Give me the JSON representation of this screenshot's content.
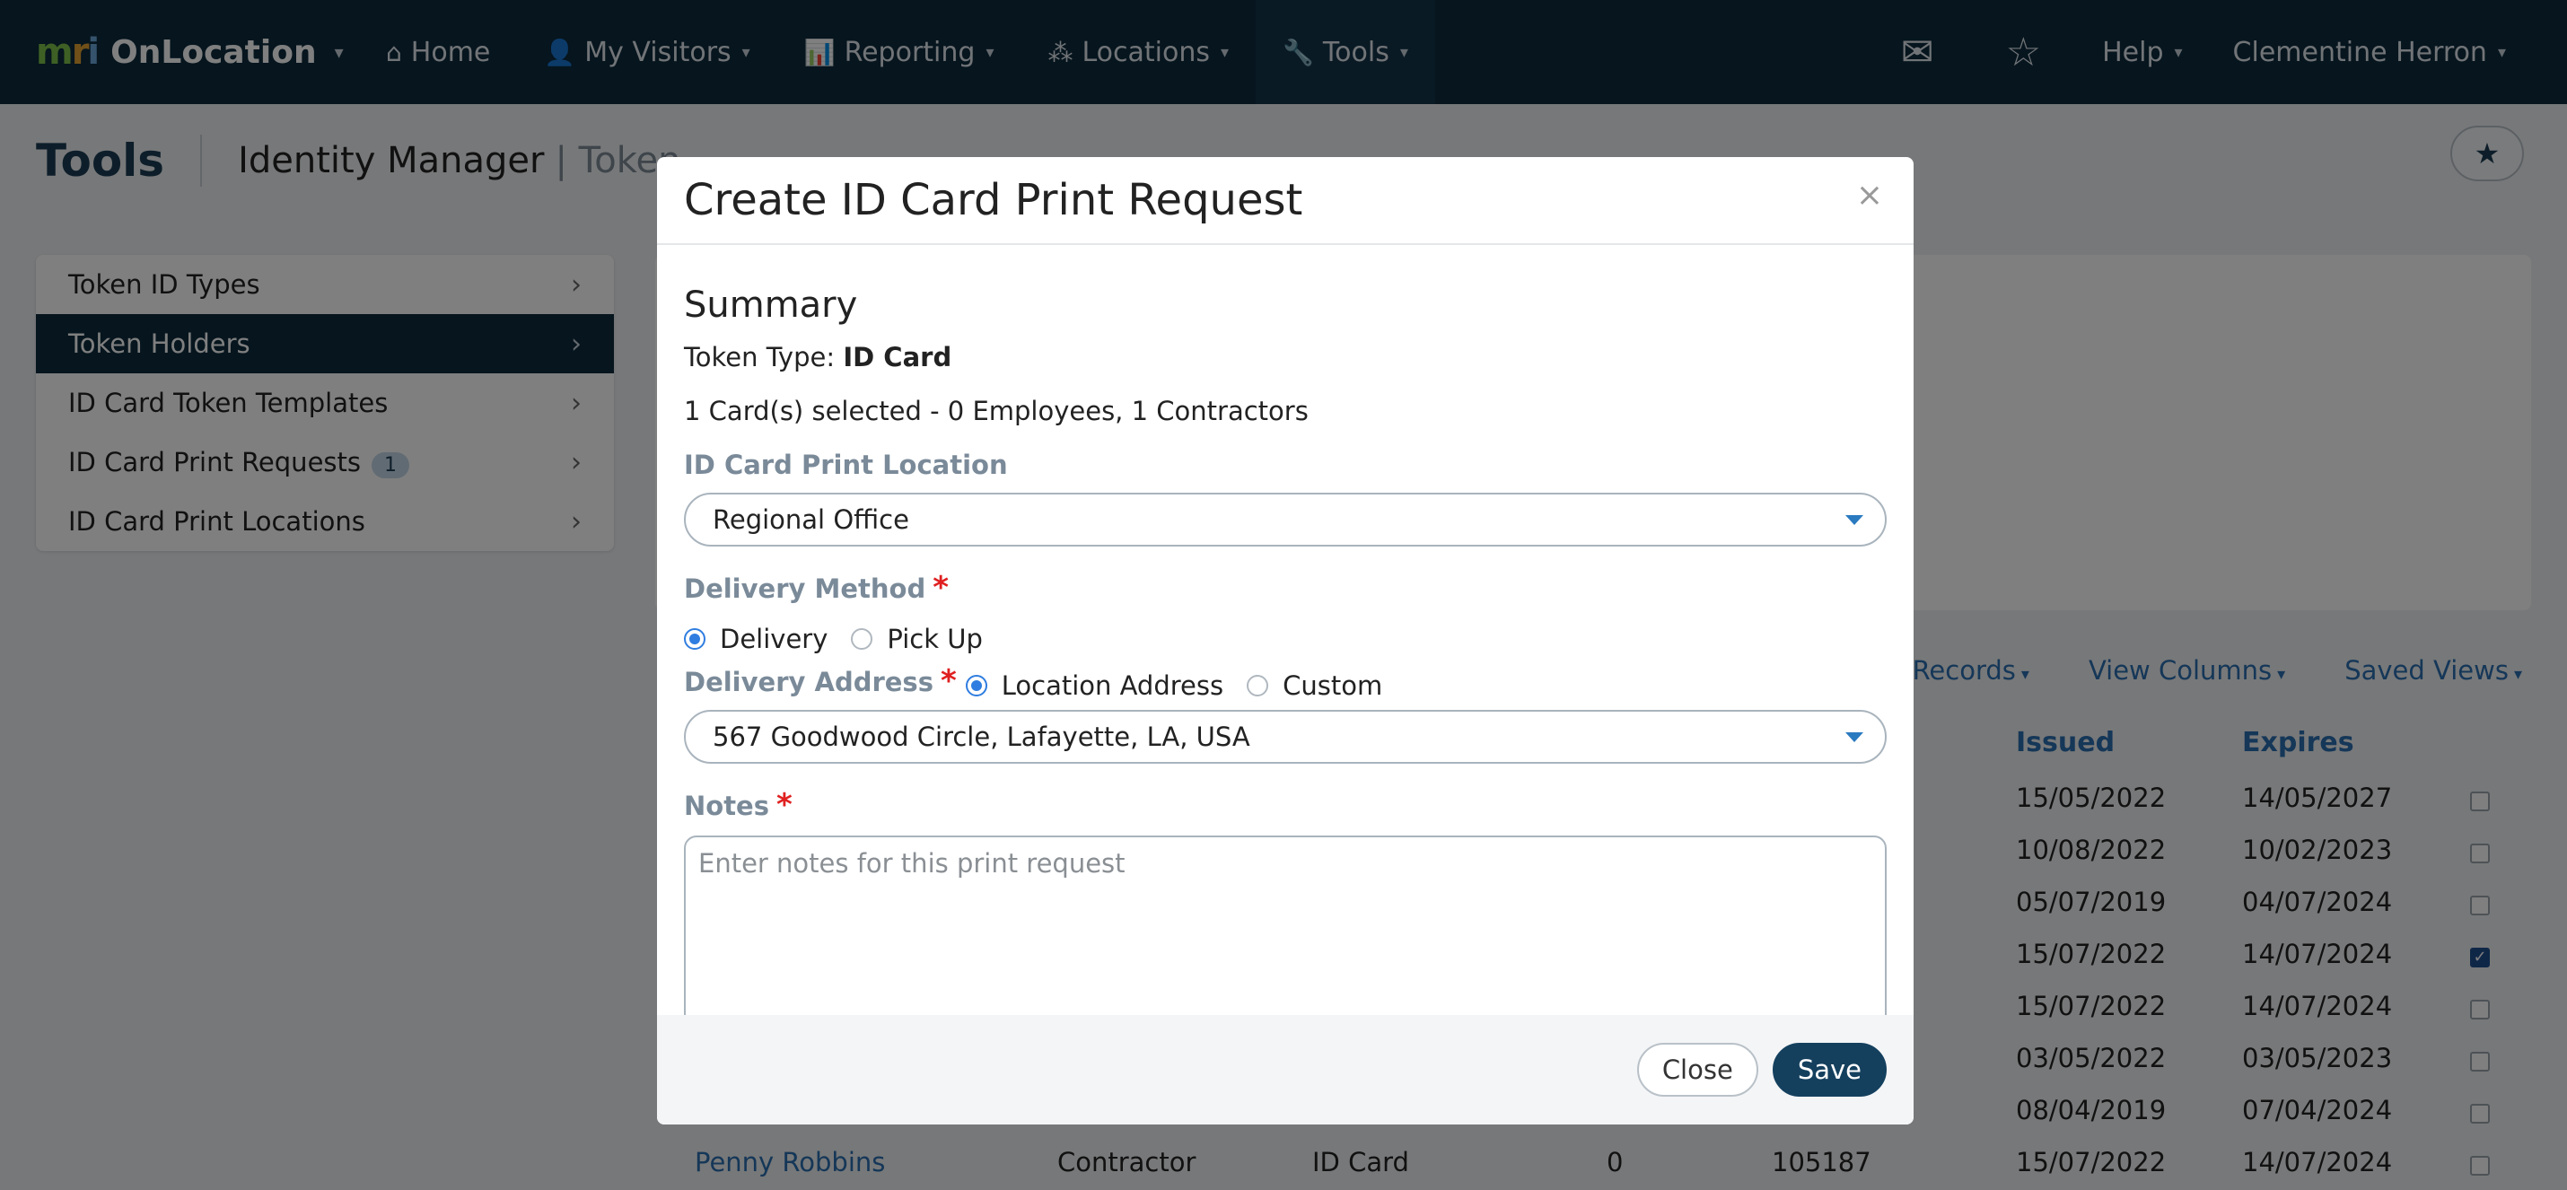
{
  "nav": {
    "brand": "OnLocation",
    "items": [
      {
        "label": "Home",
        "icon": "home-icon"
      },
      {
        "label": "My Visitors",
        "icon": "user-icon"
      },
      {
        "label": "Reporting",
        "icon": "bar-chart-icon"
      },
      {
        "label": "Locations",
        "icon": "network-icon"
      },
      {
        "label": "Tools",
        "icon": "wrench-icon"
      }
    ],
    "help": "Help",
    "user": "Clementine Herron"
  },
  "page": {
    "title": "Tools",
    "subtitle": "Identity Manager",
    "crumb": "| Token"
  },
  "sidebar": {
    "items": [
      {
        "label": "Token ID Types"
      },
      {
        "label": "Token Holders"
      },
      {
        "label": "ID Card Token Templates"
      },
      {
        "label": "ID Card Print Requests",
        "badge": "1"
      },
      {
        "label": "ID Card Print Locations"
      }
    ]
  },
  "toolbar": {
    "records": "# Records",
    "view_columns": "View Columns",
    "saved_views": "Saved Views"
  },
  "table": {
    "headers": {
      "issued": "Issued",
      "expires": "Expires"
    },
    "rows": [
      {
        "issued": "15/05/2022",
        "expires": "14/05/2027",
        "checked": false
      },
      {
        "issued": "10/08/2022",
        "expires": "10/02/2023",
        "checked": false
      },
      {
        "issued": "05/07/2019",
        "expires": "04/07/2024",
        "checked": false
      },
      {
        "issued": "15/07/2022",
        "expires": "14/07/2024",
        "checked": true
      },
      {
        "issued": "15/07/2022",
        "expires": "14/07/2024",
        "checked": false
      },
      {
        "issued": "03/05/2022",
        "expires": "03/05/2023",
        "checked": false
      },
      {
        "issued": "08/04/2019",
        "expires": "07/04/2024",
        "checked": false
      },
      {
        "issued": "15/07/2022",
        "expires": "14/07/2024",
        "checked": false
      }
    ],
    "last_row": {
      "name": "Penny Robbins",
      "type": "Contractor",
      "token": "ID Card",
      "count": "0",
      "id": "105187"
    }
  },
  "modal": {
    "title": "Create ID Card Print Request",
    "close_x": "×",
    "summary_heading": "Summary",
    "token_type_label": "Token Type:",
    "token_type_value": "ID Card",
    "selection_text": "1 Card(s) selected - 0 Employees, 1 Contractors",
    "print_location_label": "ID Card Print Location",
    "print_location_value": "Regional Office",
    "delivery_method_label": "Delivery Method",
    "delivery_options": [
      "Delivery",
      "Pick Up"
    ],
    "delivery_address_label": "Delivery Address",
    "address_options": [
      "Location Address",
      "Custom"
    ],
    "address_value": "567 Goodwood Circle, Lafayette, LA, USA",
    "notes_label": "Notes",
    "notes_placeholder": "Enter notes for this print request",
    "required_mark": "*",
    "close_button": "Close",
    "save_button": "Save"
  }
}
